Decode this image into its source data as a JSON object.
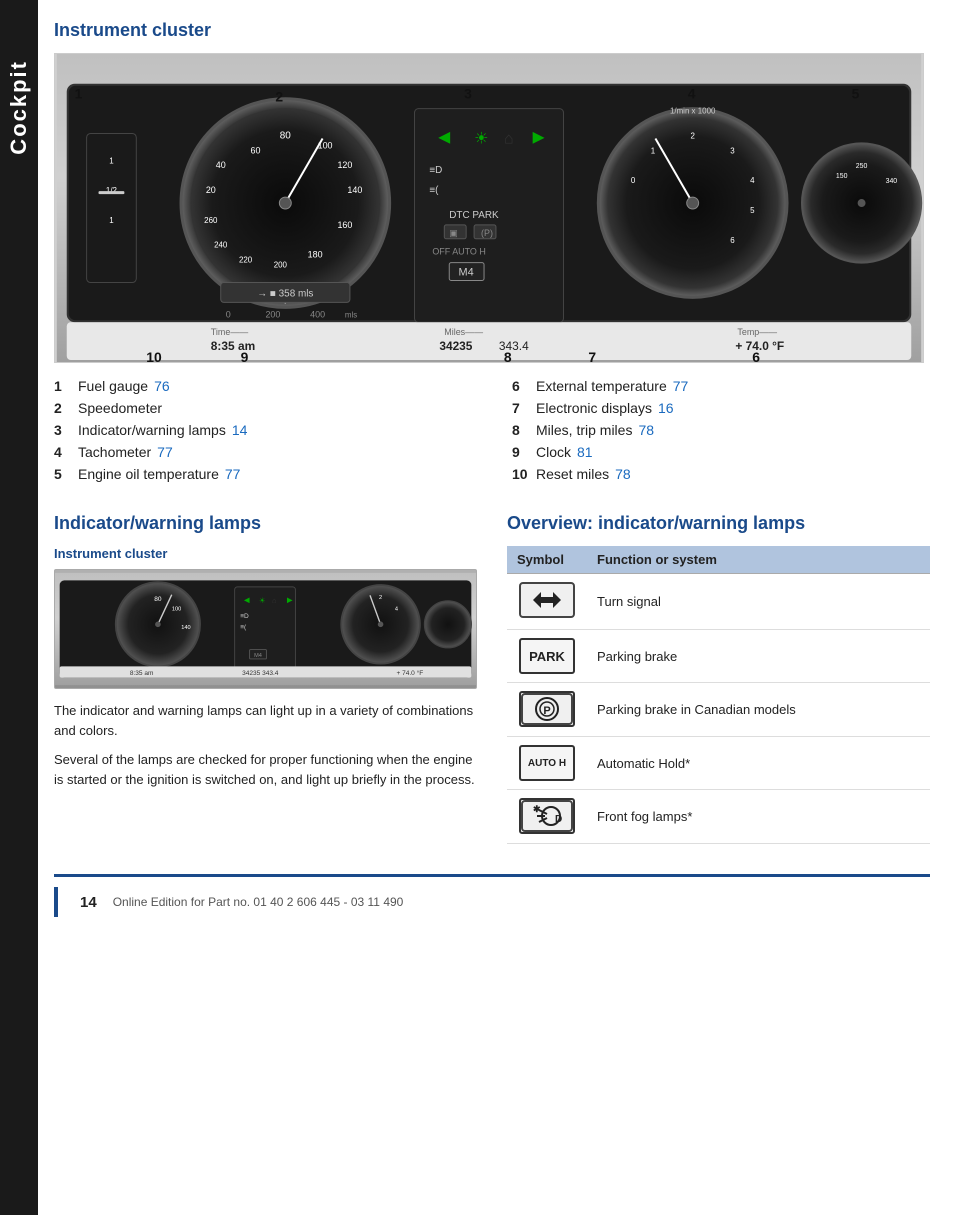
{
  "sidebar": {
    "label": "Cockpit"
  },
  "page_number": "14",
  "footer_text": "Online Edition for Part no. 01 40 2 606 445 - 03 11 490",
  "instrument_cluster": {
    "title": "Instrument cluster",
    "callouts": {
      "1": "1",
      "2": "2",
      "3": "3",
      "4": "4",
      "5": "5",
      "6": "6",
      "7": "7",
      "8": "8",
      "9": "9",
      "10": "10"
    },
    "time_label": "Time",
    "time_value": "8:35 am",
    "miles_label": "Miles",
    "miles_value": "34235",
    "miles_trip": "343.4",
    "temp_label": "Temp",
    "temp_value": "+ 74.0 °F",
    "items_left": [
      {
        "number": "1",
        "label": "Fuel gauge",
        "link": "76"
      },
      {
        "number": "2",
        "label": "Speedometer",
        "link": ""
      },
      {
        "number": "3",
        "label": "Indicator/warning lamps",
        "link": "14"
      },
      {
        "number": "4",
        "label": "Tachometer",
        "link": "77"
      },
      {
        "number": "5",
        "label": "Engine oil temperature",
        "link": "77"
      }
    ],
    "items_right": [
      {
        "number": "6",
        "label": "External temperature",
        "link": "77"
      },
      {
        "number": "7",
        "label": "Electronic displays",
        "link": "16"
      },
      {
        "number": "8",
        "label": "Miles, trip miles",
        "link": "78"
      },
      {
        "number": "9",
        "label": "Clock",
        "link": "81"
      },
      {
        "number": "10",
        "label": "Reset miles",
        "link": "78"
      }
    ]
  },
  "warning_lamps": {
    "title": "Indicator/warning lamps",
    "subsection_title": "Instrument cluster",
    "body1": "The indicator and warning lamps can light up in a variety of combinations and colors.",
    "body2": "Several of the lamps are checked for proper functioning when the engine is started or the ignition is switched on, and light up briefly in the process."
  },
  "overview": {
    "title": "Overview: indicator/warning lamps",
    "col_symbol": "Symbol",
    "col_function": "Function or system",
    "rows": [
      {
        "symbol_type": "arrow",
        "symbol": "↔",
        "function": "Turn signal"
      },
      {
        "symbol_type": "text",
        "symbol": "PARK",
        "function": "Parking brake"
      },
      {
        "symbol_type": "text",
        "symbol": "®",
        "function": "Parking brake in Canadian models"
      },
      {
        "symbol_type": "text",
        "symbol": "AUTO H",
        "function": "Automatic Hold*"
      },
      {
        "symbol_type": "fog",
        "symbol": "✤D",
        "function": "Front fog lamps*"
      }
    ]
  }
}
